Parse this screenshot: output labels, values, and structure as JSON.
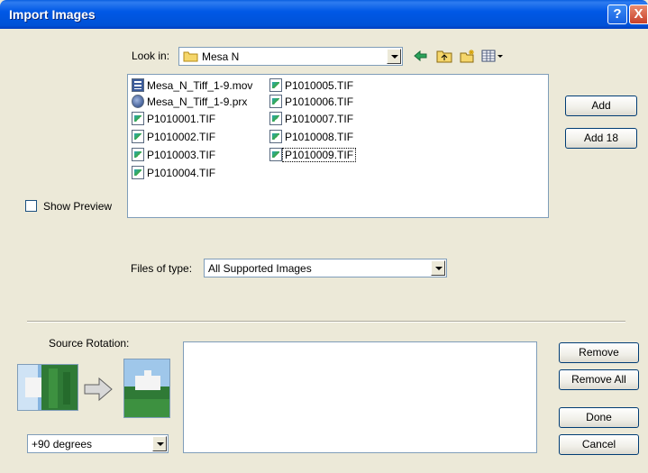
{
  "window": {
    "title": "Import Images",
    "help_label": "?",
    "close_label": "X"
  },
  "look_in": {
    "label": "Look in:",
    "value": "Mesa N",
    "icons": [
      "back-arrow-icon",
      "up-folder-icon",
      "new-folder-icon",
      "view-menu-icon"
    ]
  },
  "files": [
    {
      "name": "Mesa_N_Tiff_1-9.mov",
      "type": "mov",
      "focused": false
    },
    {
      "name": "Mesa_N_Tiff_1-9.prx",
      "type": "prx",
      "focused": false
    },
    {
      "name": "P1010001.TIF",
      "type": "tif",
      "focused": false
    },
    {
      "name": "P1010002.TIF",
      "type": "tif",
      "focused": false
    },
    {
      "name": "P1010003.TIF",
      "type": "tif",
      "focused": false
    },
    {
      "name": "P1010004.TIF",
      "type": "tif",
      "focused": false
    },
    {
      "name": "P1010005.TIF",
      "type": "tif",
      "focused": false
    },
    {
      "name": "P1010006.TIF",
      "type": "tif",
      "focused": false
    },
    {
      "name": "P1010007.TIF",
      "type": "tif",
      "focused": false
    },
    {
      "name": "P1010008.TIF",
      "type": "tif",
      "focused": false
    },
    {
      "name": "P1010009.TIF",
      "type": "tif",
      "focused": true
    }
  ],
  "buttons": {
    "add": "Add",
    "add_all": "Add 18",
    "remove": "Remove",
    "remove_all": "Remove All",
    "done": "Done",
    "cancel": "Cancel"
  },
  "show_preview": {
    "label": "Show Preview",
    "checked": false
  },
  "files_of_type": {
    "label": "Files of type:",
    "value": "All Supported Images"
  },
  "source_rotation": {
    "label": "Source Rotation:",
    "value": "+90 degrees"
  },
  "colors": {
    "titlebar": "#0054e3",
    "dialog_bg": "#ece9d8",
    "field_border": "#7f9db9"
  }
}
